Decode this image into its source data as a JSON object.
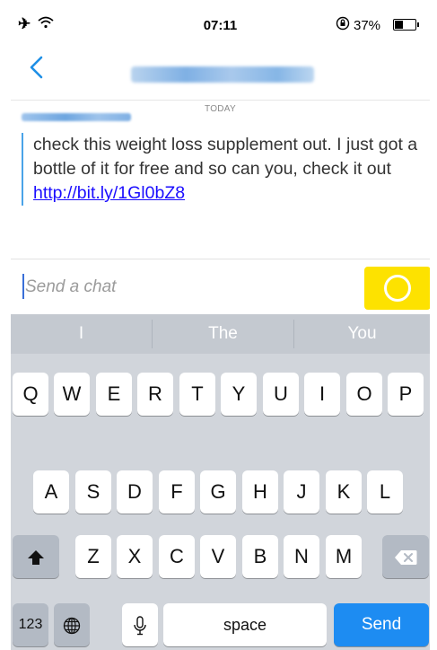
{
  "status_bar": {
    "time": "07:11",
    "battery_percent": "37%",
    "battery_level": 0.37,
    "icons": [
      "airplane-icon",
      "wifi-icon",
      "rotation-lock-icon",
      "battery-icon"
    ]
  },
  "nav": {
    "back_icon": "chevron-left-icon"
  },
  "chat": {
    "date_label": "TODAY",
    "message_text": "check this weight loss supplement out. I just got a bottle of it for free and so can you, check it out ",
    "message_link": "http://bit.ly/1Gl0bZ8"
  },
  "input": {
    "placeholder": "Send a chat",
    "camera_icon": "camera-shutter-icon"
  },
  "keyboard": {
    "suggestions": [
      "I",
      "The",
      "You"
    ],
    "row1": [
      "Q",
      "W",
      "E",
      "R",
      "T",
      "Y",
      "U",
      "I",
      "O",
      "P"
    ],
    "row2": [
      "A",
      "S",
      "D",
      "F",
      "G",
      "H",
      "J",
      "K",
      "L"
    ],
    "row3": [
      "Z",
      "X",
      "C",
      "V",
      "B",
      "N",
      "M"
    ],
    "numbers_label": "123",
    "space_label": "space",
    "send_label": "Send"
  },
  "colors": {
    "accent_blue": "#1d8cf2",
    "camera_yellow": "#fde200",
    "link_blue": "#1a0dff"
  }
}
